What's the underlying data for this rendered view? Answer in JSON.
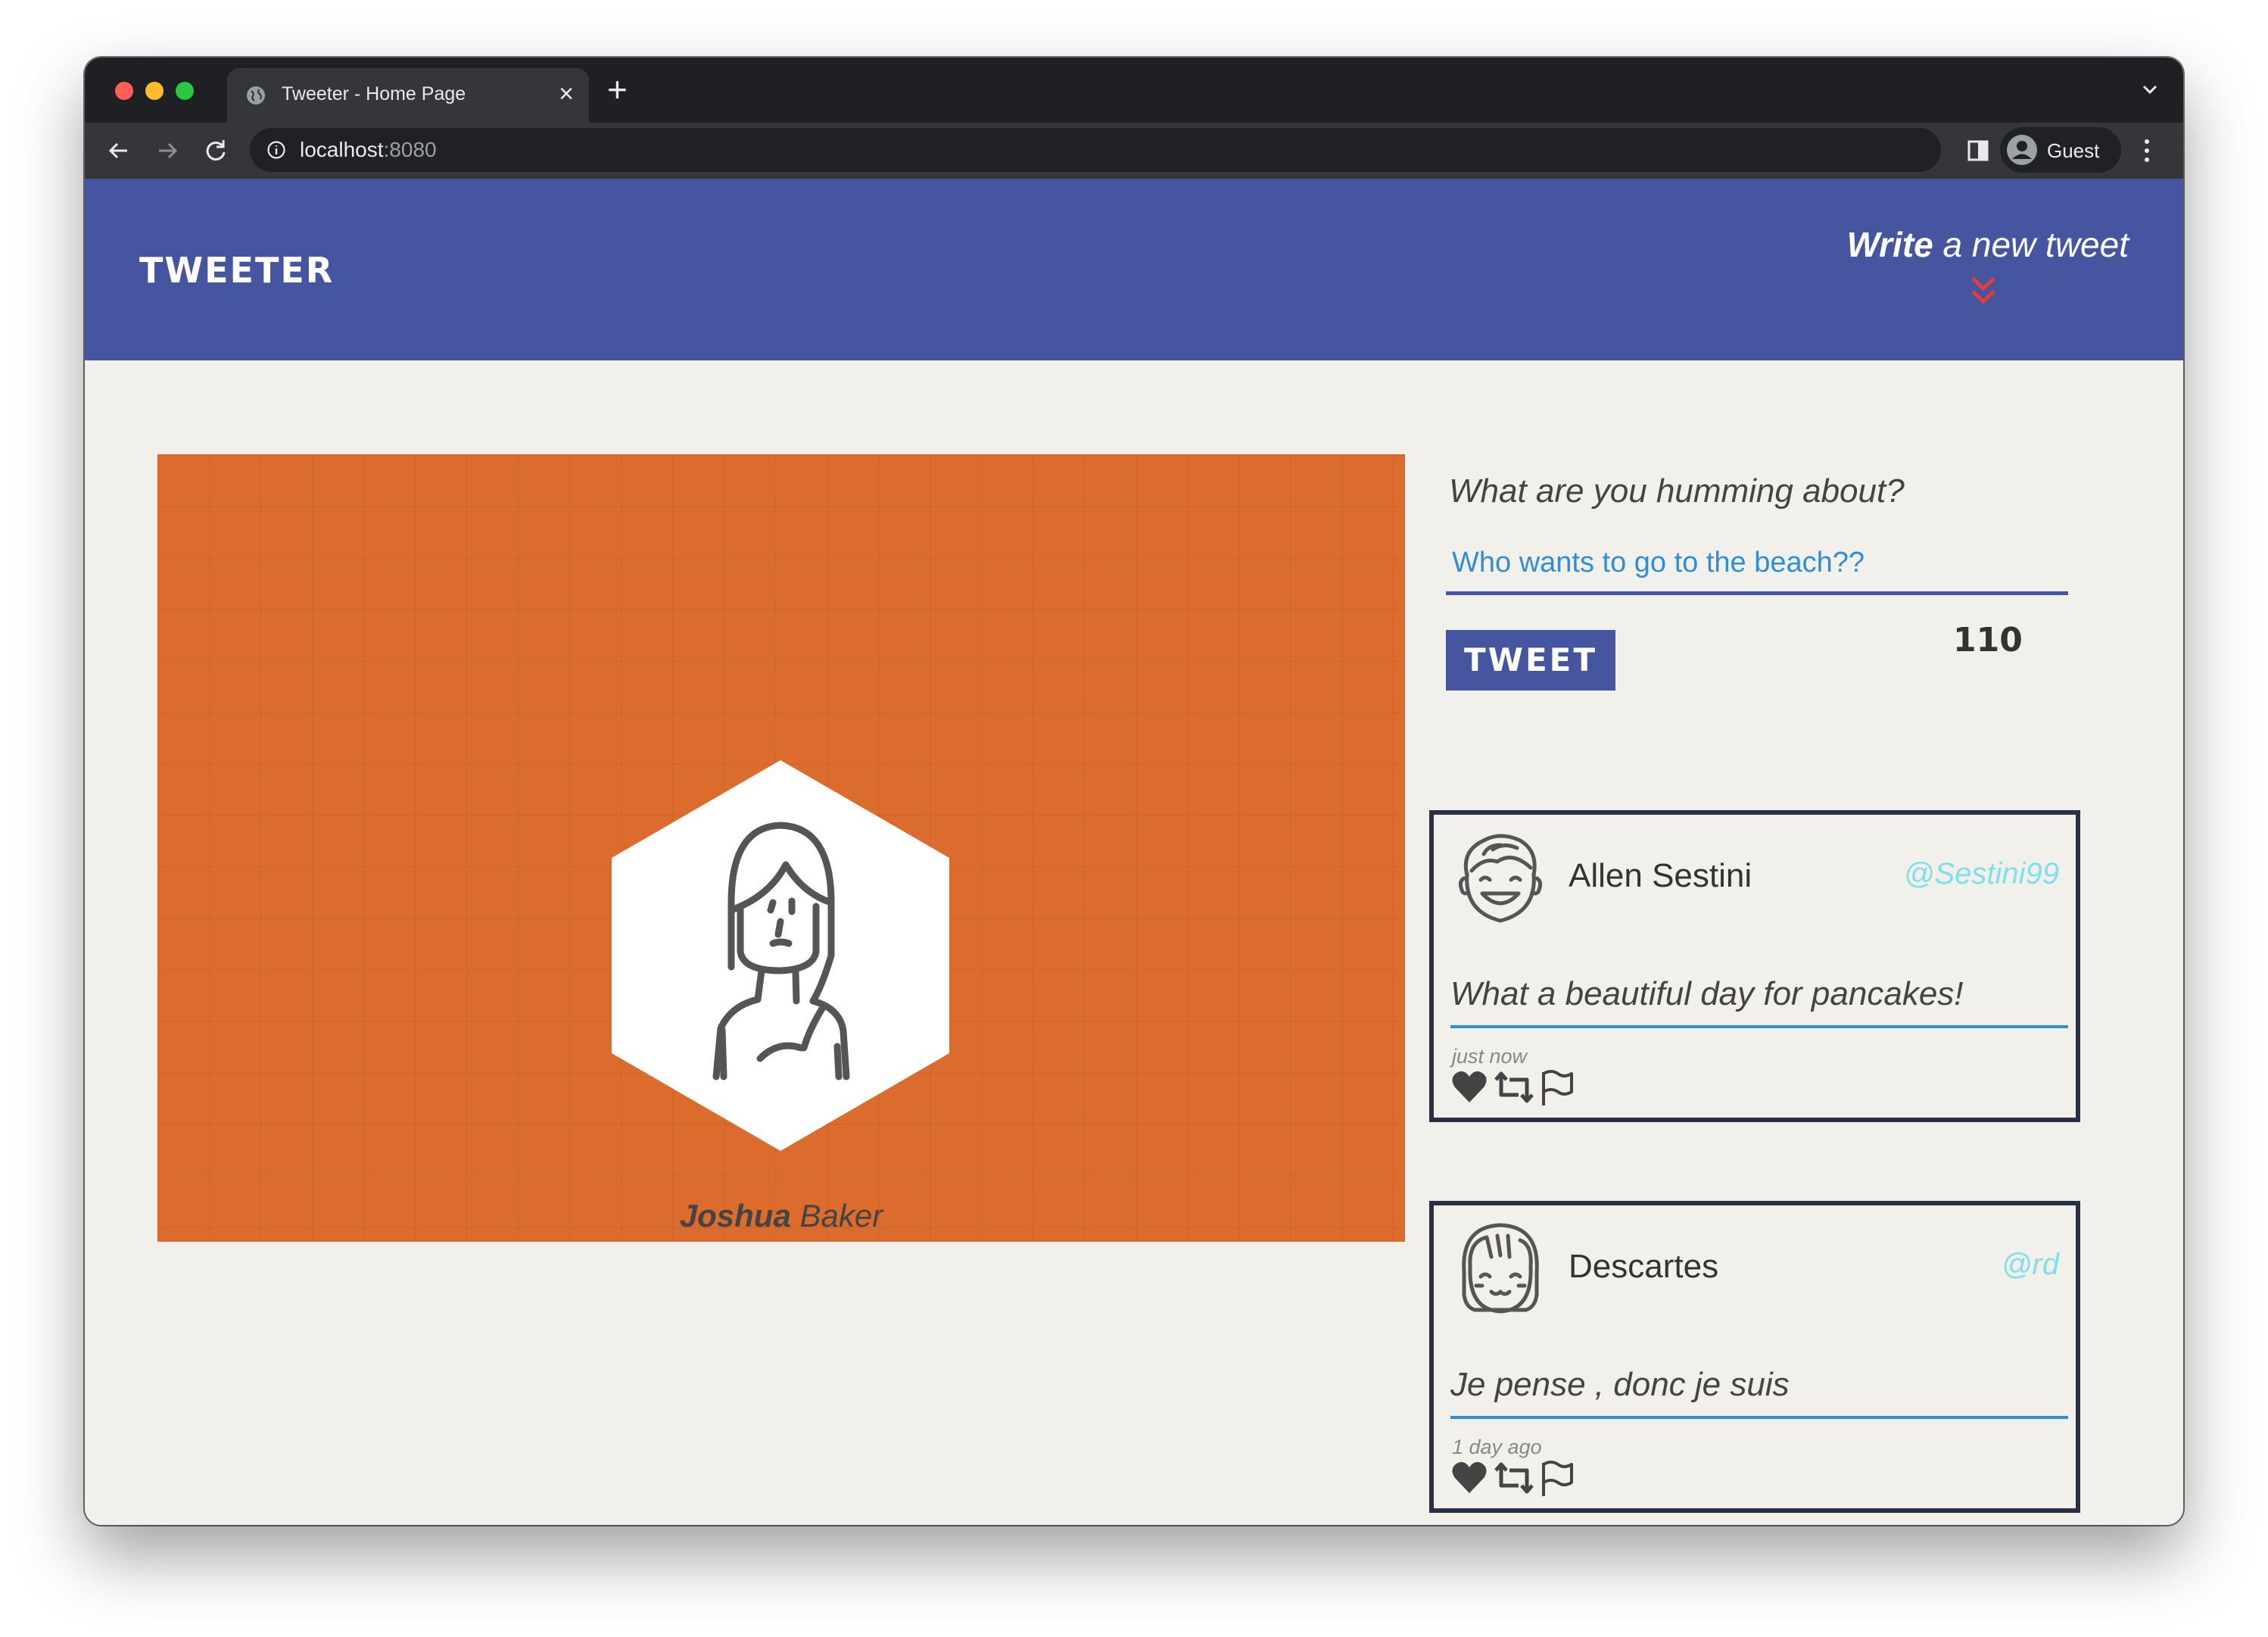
{
  "browser": {
    "tab_title": "Tweeter - Home Page",
    "close_glyph": "×",
    "newtab_glyph": "+",
    "url_host": "localhost",
    "url_port": ":8080",
    "profile_label": "Guest"
  },
  "nav": {
    "brand": "TWEETER",
    "compose_bold": "Write",
    "compose_rest": " a new tweet",
    "compose_icon": "double-chevron-down-icon",
    "compose_icon_color": "#e83a3a"
  },
  "profile": {
    "first_name": "Joshua",
    "last_name": " Baker",
    "background_color": "#dc6b2e"
  },
  "composer": {
    "prompt": "What are you humming about?",
    "input_value": "Who wants to go to the beach??",
    "button_label": "TWEET",
    "counter": "110"
  },
  "tweets": [
    {
      "name": "Allen Sestini",
      "handle": "@Sestini99",
      "content": "What a beautiful day for pancakes!",
      "timestamp": "just now",
      "actions": [
        "heart-icon",
        "retweet-icon",
        "flag-icon"
      ]
    },
    {
      "name": "Descartes",
      "handle": "@rd",
      "content": "Je pense , donc je suis",
      "timestamp": "1 day ago",
      "actions": [
        "heart-icon",
        "retweet-icon",
        "flag-icon"
      ]
    }
  ],
  "colors": {
    "nav_blue": "#4555a0",
    "page_bg": "#f2f0eb",
    "handle_cyan": "#7fe0ec",
    "input_blue": "#2f8fd6",
    "card_border": "#293046"
  }
}
